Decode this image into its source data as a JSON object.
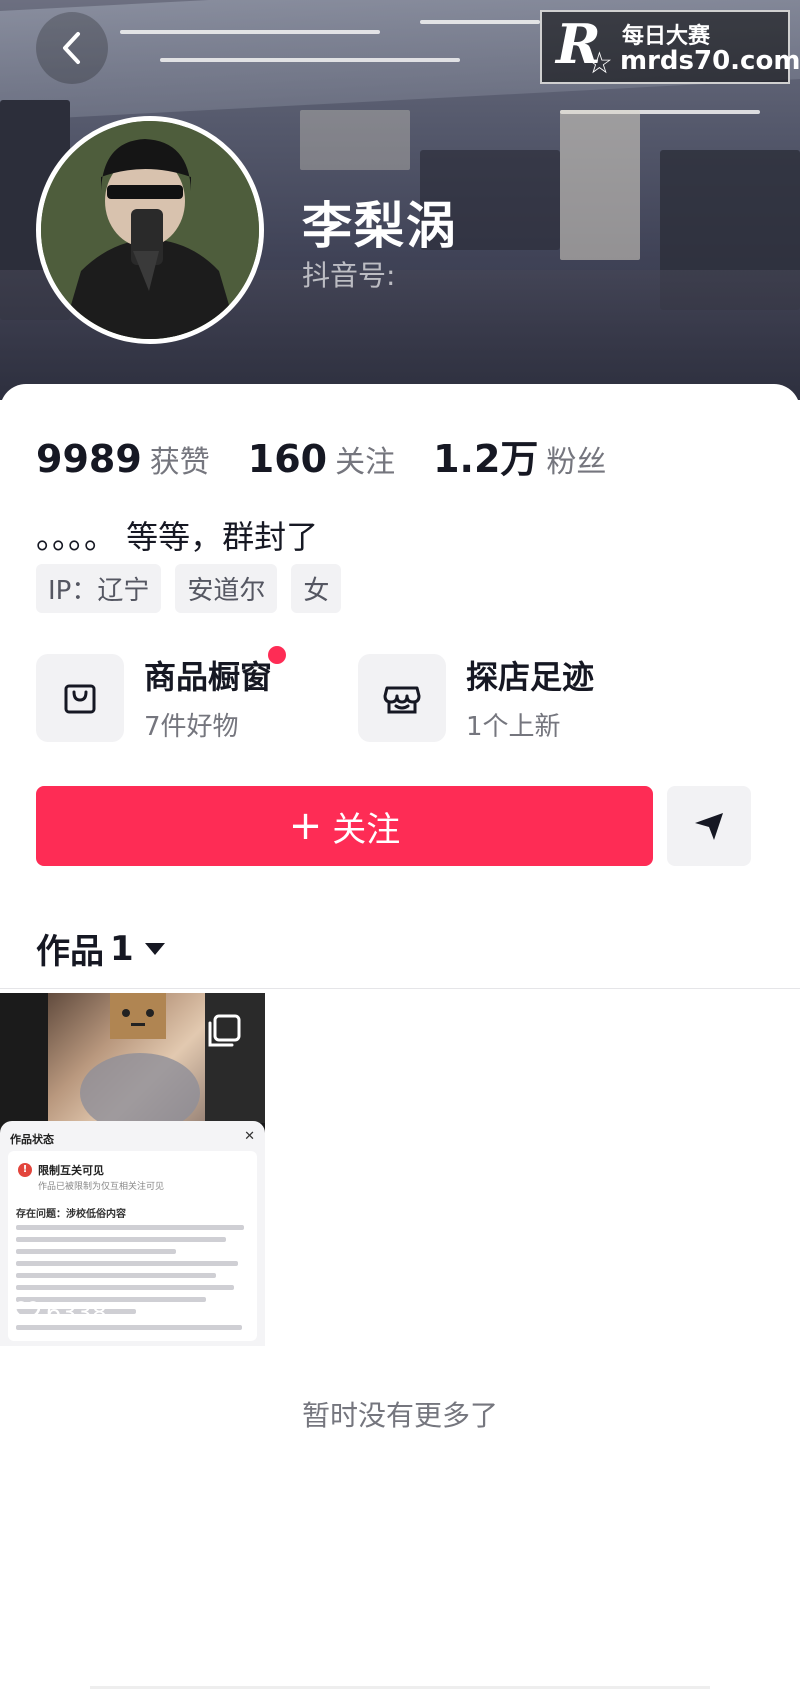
{
  "header": {
    "back_label": "返回",
    "watermark_brand": "每日大赛",
    "watermark_letter": "R",
    "watermark_url": "mrds70.com"
  },
  "profile": {
    "name": "李梨涡",
    "douyin_id_label": "抖音号:"
  },
  "stats": [
    {
      "value": "9989",
      "label": "获赞"
    },
    {
      "value": "160",
      "label": "关注"
    },
    {
      "value": "1.2万",
      "label": "粉丝"
    }
  ],
  "bio": "。。。。 等等，群封了",
  "tags": [
    "IP：辽宁",
    "安道尔",
    "女"
  ],
  "features": {
    "showcase": {
      "title": "商品橱窗",
      "subtitle": "7件好物"
    },
    "shop_visits": {
      "title": "探店足迹",
      "subtitle": "1个上新"
    }
  },
  "actions": {
    "follow_plus": "+",
    "follow_label": "关注"
  },
  "works": {
    "tab_label": "作品",
    "count": "1",
    "items": [
      {
        "likes": "6338",
        "sheet_title": "作品状态",
        "status_title": "限制互关可见",
        "status_sub": "作品已被限制为仅互相关注可见",
        "issue_heading": "存在问题：涉校低俗内容"
      }
    ],
    "end_text": "暂时没有更多了"
  },
  "colors": {
    "accent": "#fe2c55",
    "text_primary": "#161823",
    "text_secondary": "#75767e",
    "chip_bg": "#f2f2f4"
  }
}
